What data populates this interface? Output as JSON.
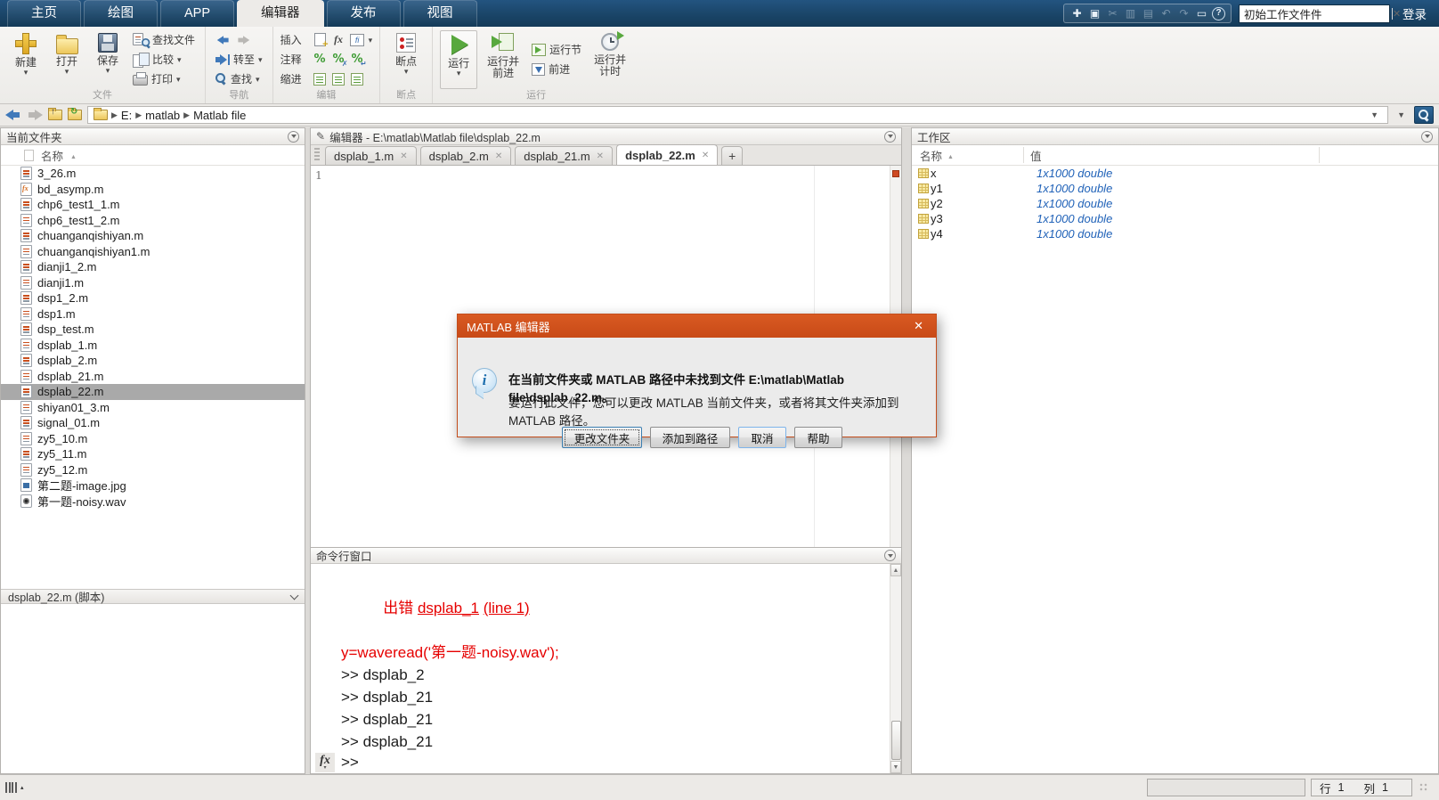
{
  "topbar": {
    "tabs": [
      {
        "label": "主页"
      },
      {
        "label": "绘图"
      },
      {
        "label": "APP"
      },
      {
        "label": "编辑器",
        "active": true
      },
      {
        "label": "发布"
      },
      {
        "label": "视图"
      }
    ],
    "quick_access": [
      {
        "name": "new-script-icon",
        "glyph": "✚"
      },
      {
        "name": "save-icon",
        "glyph": "▣"
      },
      {
        "name": "cut-icon",
        "glyph": "✂",
        "disabled": true
      },
      {
        "name": "copy-icon",
        "glyph": "▥",
        "disabled": true
      },
      {
        "name": "paste-icon",
        "glyph": "▤",
        "disabled": true
      },
      {
        "name": "undo-icon",
        "glyph": "↶",
        "disabled": true
      },
      {
        "name": "redo-icon",
        "glyph": "↷",
        "disabled": true
      },
      {
        "name": "new-window-icon",
        "glyph": "▭"
      },
      {
        "name": "help-icon",
        "glyph": "?"
      }
    ],
    "search_value": "初始工作文件件",
    "search_clear": "✕",
    "signin": "登录"
  },
  "ribbon": {
    "file": {
      "new": "新建",
      "open": "打开",
      "save": "保存",
      "find_files": "查找文件",
      "compare": "比较",
      "print": "打印",
      "label": "文件"
    },
    "navigate": {
      "go_to": "转至",
      "find": "查找",
      "label": "导航"
    },
    "edit": {
      "insert": "插入",
      "comment": "注释",
      "indent": "缩进",
      "label": "编辑"
    },
    "breakpoints": {
      "button": "断点",
      "label": "断点"
    },
    "run": {
      "run": "运行",
      "run_advance": "运行并前进",
      "run_section": "运行节",
      "advance": "前进",
      "run_time": "运行并计时",
      "label": "运行"
    }
  },
  "addressbar": {
    "breadcrumb": [
      {
        "label": "E:"
      },
      {
        "label": "matlab"
      },
      {
        "label": "Matlab file"
      }
    ]
  },
  "current_folder": {
    "title": "当前文件夹",
    "name_column": "名称",
    "files": [
      {
        "name": "3_26.m",
        "icon": "mfile"
      },
      {
        "name": "bd_asymp.m",
        "icon": "mfunction"
      },
      {
        "name": "chp6_test1_1.m",
        "icon": "mfile"
      },
      {
        "name": "chp6_test1_2.m",
        "icon": "mfile"
      },
      {
        "name": "chuanganqishiyan.m",
        "icon": "mfile"
      },
      {
        "name": "chuanganqishiyan1.m",
        "icon": "mfile"
      },
      {
        "name": "dianji1_2.m",
        "icon": "mfile"
      },
      {
        "name": "dianji1.m",
        "icon": "mfile"
      },
      {
        "name": "dsp1_2.m",
        "icon": "mfile"
      },
      {
        "name": "dsp1.m",
        "icon": "mfile"
      },
      {
        "name": "dsp_test.m",
        "icon": "mfile"
      },
      {
        "name": "dsplab_1.m",
        "icon": "mfile"
      },
      {
        "name": "dsplab_2.m",
        "icon": "mfile"
      },
      {
        "name": "dsplab_21.m",
        "icon": "mfile"
      },
      {
        "name": "dsplab_22.m",
        "icon": "mfile",
        "selected": true
      },
      {
        "name": "shiyan01_3.m",
        "icon": "mfile"
      },
      {
        "name": "signal_01.m",
        "icon": "mfile"
      },
      {
        "name": "zy5_10.m",
        "icon": "mfile"
      },
      {
        "name": "zy5_11.m",
        "icon": "mfile"
      },
      {
        "name": "zy5_12.m",
        "icon": "mfile"
      },
      {
        "name": "第二题-image.jpg",
        "icon": "image"
      },
      {
        "name": "第一题-noisy.wav",
        "icon": "audio"
      }
    ],
    "details": "dsplab_22.m  (脚本)"
  },
  "editor": {
    "title": "编辑器 - E:\\matlab\\Matlab file\\dsplab_22.m",
    "tabs": [
      {
        "label": "dsplab_1.m"
      },
      {
        "label": "dsplab_2.m"
      },
      {
        "label": "dsplab_21.m"
      },
      {
        "label": "dsplab_22.m",
        "active": true
      }
    ],
    "tab_close": "✕",
    "new_tab": "+",
    "line_number": "1"
  },
  "command_window": {
    "title": "命令行窗口",
    "error_prefix": "出错 ",
    "error_file": "dsplab_1",
    "error_line": "(line 1)",
    "error_code": "y=waveread('第一题-noisy.wav');",
    "commands": [
      {
        "text": ">> dsplab_2"
      },
      {
        "text": ">> dsplab_21"
      },
      {
        "text": ">> dsplab_21"
      },
      {
        "text": ">> dsplab_21"
      }
    ],
    "fx": "fx",
    "prompt": ">>"
  },
  "workspace": {
    "title": "工作区",
    "columns": {
      "name": "名称",
      "value": "值"
    },
    "variables": [
      {
        "name": "x",
        "value": "1x1000 double"
      },
      {
        "name": "y1",
        "value": "1x1000 double"
      },
      {
        "name": "y2",
        "value": "1x1000 double"
      },
      {
        "name": "y3",
        "value": "1x1000 double"
      },
      {
        "name": "y4",
        "value": "1x1000 double"
      }
    ]
  },
  "dialog": {
    "title": "MATLAB 编辑器",
    "close": "✕",
    "info_glyph": "i",
    "message_main": "在当前文件夹或 MATLAB 路径中未找到文件 E:\\matlab\\Matlab file\\dsplab_22.m。",
    "message_sub": "要运行此文件，您可以更改 MATLAB 当前文件夹，或者将其文件夹添加到 MATLAB 路径。",
    "buttons": {
      "change_folder": "更改文件夹",
      "add_to_path": "添加到路径",
      "cancel": "取消",
      "help": "帮助"
    }
  },
  "statusbar": {
    "row_label": "行",
    "row_value": "1",
    "col_label": "列",
    "col_value": "1"
  },
  "colors": {
    "topbar_blue": "#1a4568",
    "dialog_orange": "#cc4f1c",
    "error_red": "#e60000",
    "value_blue": "#2062b8",
    "selection_gray": "#a9a9a9"
  }
}
